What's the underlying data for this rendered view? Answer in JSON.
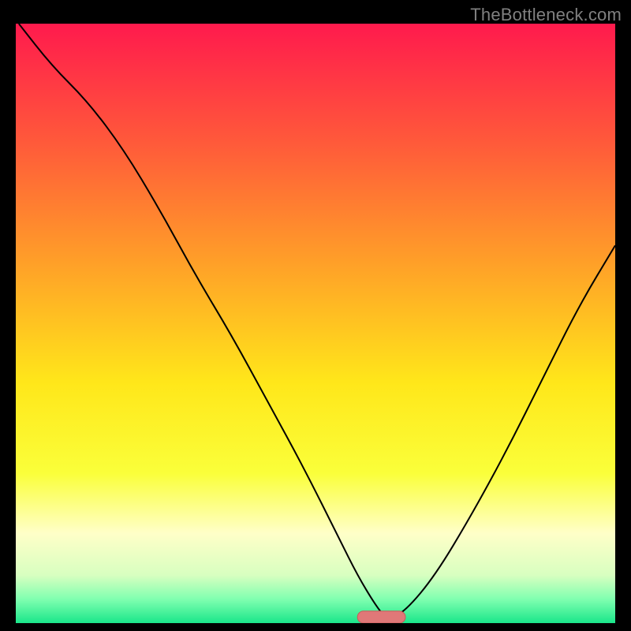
{
  "watermark": "TheBottleneck.com",
  "chart_data": {
    "type": "line",
    "title": "",
    "xlabel": "",
    "ylabel": "",
    "xlim": [
      0,
      100
    ],
    "ylim": [
      0,
      100
    ],
    "grid": false,
    "legend": false,
    "background_gradient": {
      "stops": [
        {
          "offset": 0.0,
          "color": "#ff1a4d"
        },
        {
          "offset": 0.2,
          "color": "#ff5a3a"
        },
        {
          "offset": 0.4,
          "color": "#ffa028"
        },
        {
          "offset": 0.6,
          "color": "#ffe71a"
        },
        {
          "offset": 0.75,
          "color": "#faff3a"
        },
        {
          "offset": 0.85,
          "color": "#ffffc8"
        },
        {
          "offset": 0.92,
          "color": "#d8ffc0"
        },
        {
          "offset": 0.96,
          "color": "#80ffb0"
        },
        {
          "offset": 1.0,
          "color": "#1ae68a"
        }
      ]
    },
    "series": [
      {
        "name": "bottleneck-curve",
        "stroke": "#000000",
        "stroke_width": 2,
        "x": [
          0.5,
          6,
          12,
          18,
          24,
          30,
          36,
          42,
          48,
          54,
          57,
          60,
          62,
          65,
          70,
          76,
          82,
          88,
          94,
          100
        ],
        "values": [
          100,
          93,
          87,
          79,
          69,
          58,
          48,
          37,
          26,
          14,
          8,
          3,
          0.5,
          2,
          8,
          18,
          29,
          41,
          53,
          63
        ]
      }
    ],
    "marker": {
      "name": "optimal-region",
      "shape": "pill",
      "x": 61,
      "y": 0,
      "width": 8,
      "height": 2,
      "fill": "#e07878",
      "stroke": "#c85a5a"
    }
  }
}
